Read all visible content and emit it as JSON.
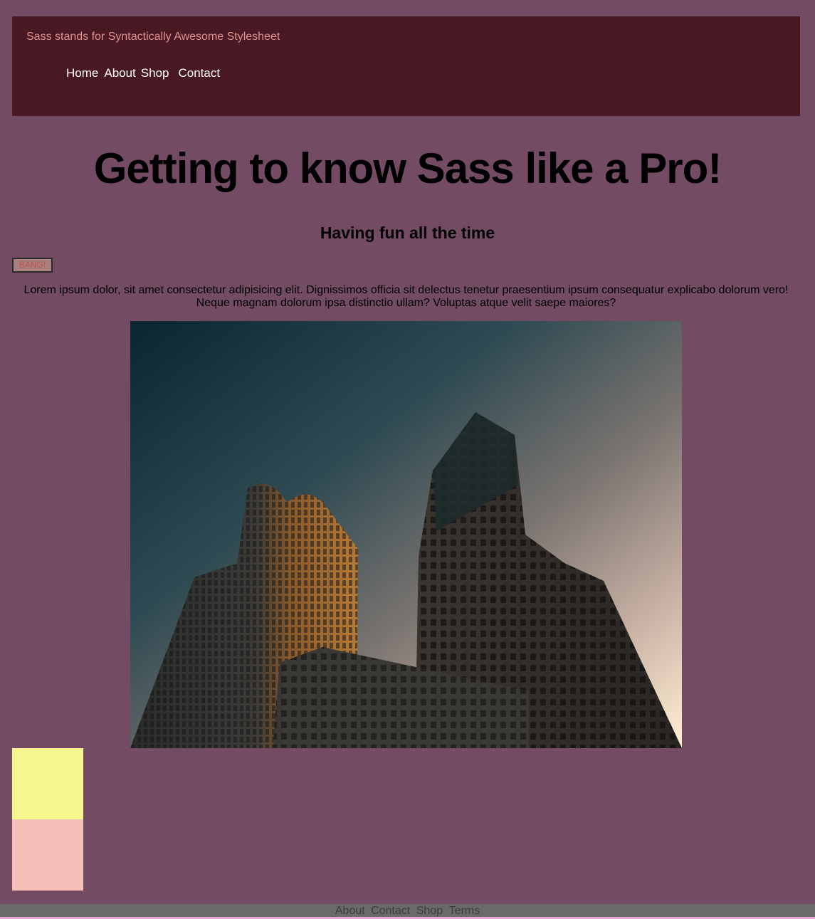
{
  "header": {
    "tagline": "Sass stands for Syntactically Awesome Stylesheet",
    "nav": [
      "Home",
      "About",
      "Shop",
      "Contact"
    ]
  },
  "main": {
    "title": "Getting to know Sass like a Pro!",
    "subtitle": "Having fun all the time",
    "button_label": "BANG!",
    "paragraph": "Lorem ipsum dolor, sit amet consectetur adipisicing elit. Dignissimos officia sit delectus tenetur praesentium ipsum consequatur explicabo dolorum vero! Neque magnam dolorum ipsa distinctio ullam? Voluptas atque velit saepe maiores?",
    "image_subject": "skyscrapers-photo"
  },
  "boxes": {
    "first_color": "#f7f78f",
    "second_color": "#f6c0b9"
  },
  "footer": {
    "links": [
      "About",
      "Contact",
      "Shop",
      "Terms"
    ]
  },
  "colors": {
    "background": "#734c63",
    "header_bg": "#481923",
    "tagline": "#e0928c",
    "footer_bg": "#6a6a6a"
  }
}
